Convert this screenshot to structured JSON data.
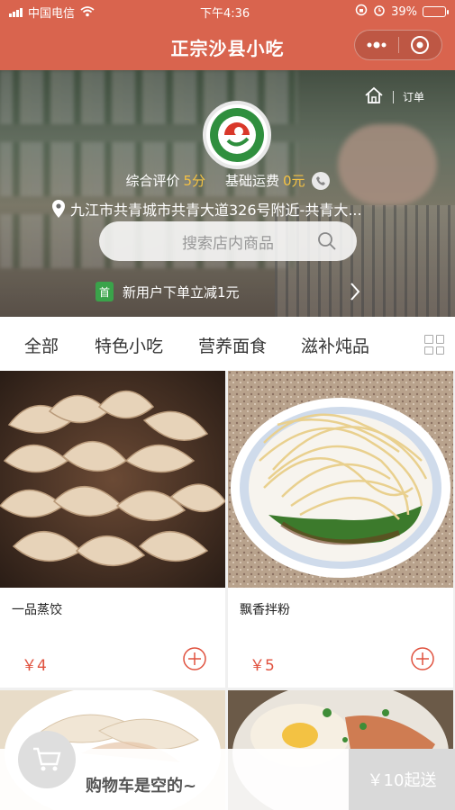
{
  "status_bar": {
    "carrier": "中国电信",
    "time": "下午4:36",
    "battery": "39%",
    "battery_level": 0.39
  },
  "nav": {
    "title": "正宗沙县小吃"
  },
  "shop": {
    "home_icon": "home-icon",
    "orders_label": "订单",
    "rating_label": "综合评价",
    "rating_value": "5分",
    "delivery_label": "基础运费",
    "delivery_value": "0元",
    "address": "九江市共青城市共青大道326号附近-共青大...",
    "search_placeholder": "搜索店内商品",
    "promo_tag": "首",
    "promo_text": "新用户下单立减1元"
  },
  "tabs": [
    {
      "label": "全部"
    },
    {
      "label": "特色小吃"
    },
    {
      "label": "营养面食"
    },
    {
      "label": "滋补炖品"
    }
  ],
  "products": [
    {
      "name": "一品蒸饺",
      "price": "￥4"
    },
    {
      "name": "飘香拌粉",
      "price": "￥5"
    }
  ],
  "cart": {
    "empty_text": "购物车是空的~",
    "checkout_label": "￥10起送"
  },
  "colors": {
    "brand": "#d9644e",
    "price": "#e0523f",
    "highlight": "#f5c243",
    "promo_green": "#3aa34a"
  }
}
